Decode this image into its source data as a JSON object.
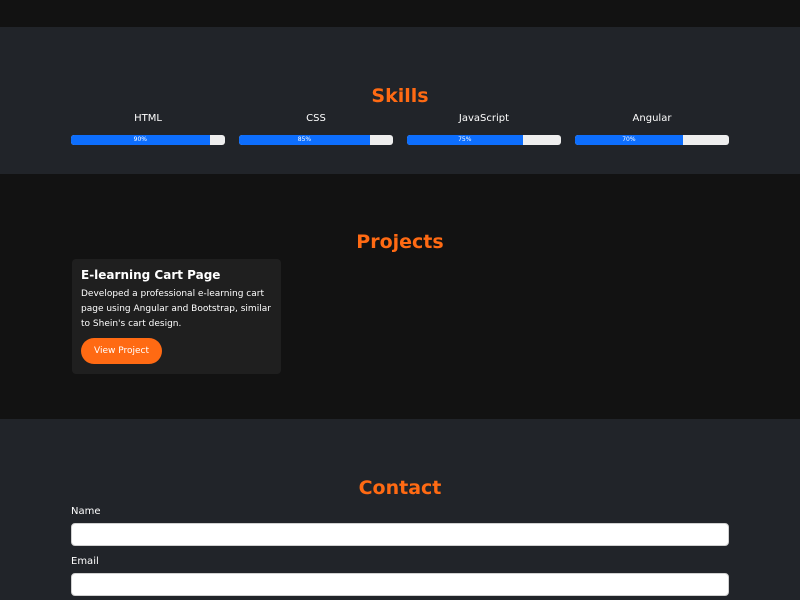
{
  "skills": {
    "title": "Skills",
    "items": [
      {
        "name": "HTML",
        "level_label": "90%",
        "level": 90
      },
      {
        "name": "CSS",
        "level_label": "85%",
        "level": 85
      },
      {
        "name": "JavaScript",
        "level_label": "75%",
        "level": 75
      },
      {
        "name": "Angular",
        "level_label": "70%",
        "level": 70
      }
    ]
  },
  "projects": {
    "title": "Projects",
    "items": [
      {
        "title": "E-learning Cart Page",
        "description": "Developed a professional e-learning cart page using Angular and Bootstrap, similar to Shein's cart design.",
        "button_label": "View Project"
      }
    ]
  },
  "contact": {
    "title": "Contact",
    "name_label": "Name",
    "name_value": "",
    "email_label": "Email",
    "email_value": ""
  },
  "colors": {
    "accent": "#ff6a13",
    "progress": "#0d6efd",
    "section_dark": "#121212",
    "section_light": "#212429"
  }
}
